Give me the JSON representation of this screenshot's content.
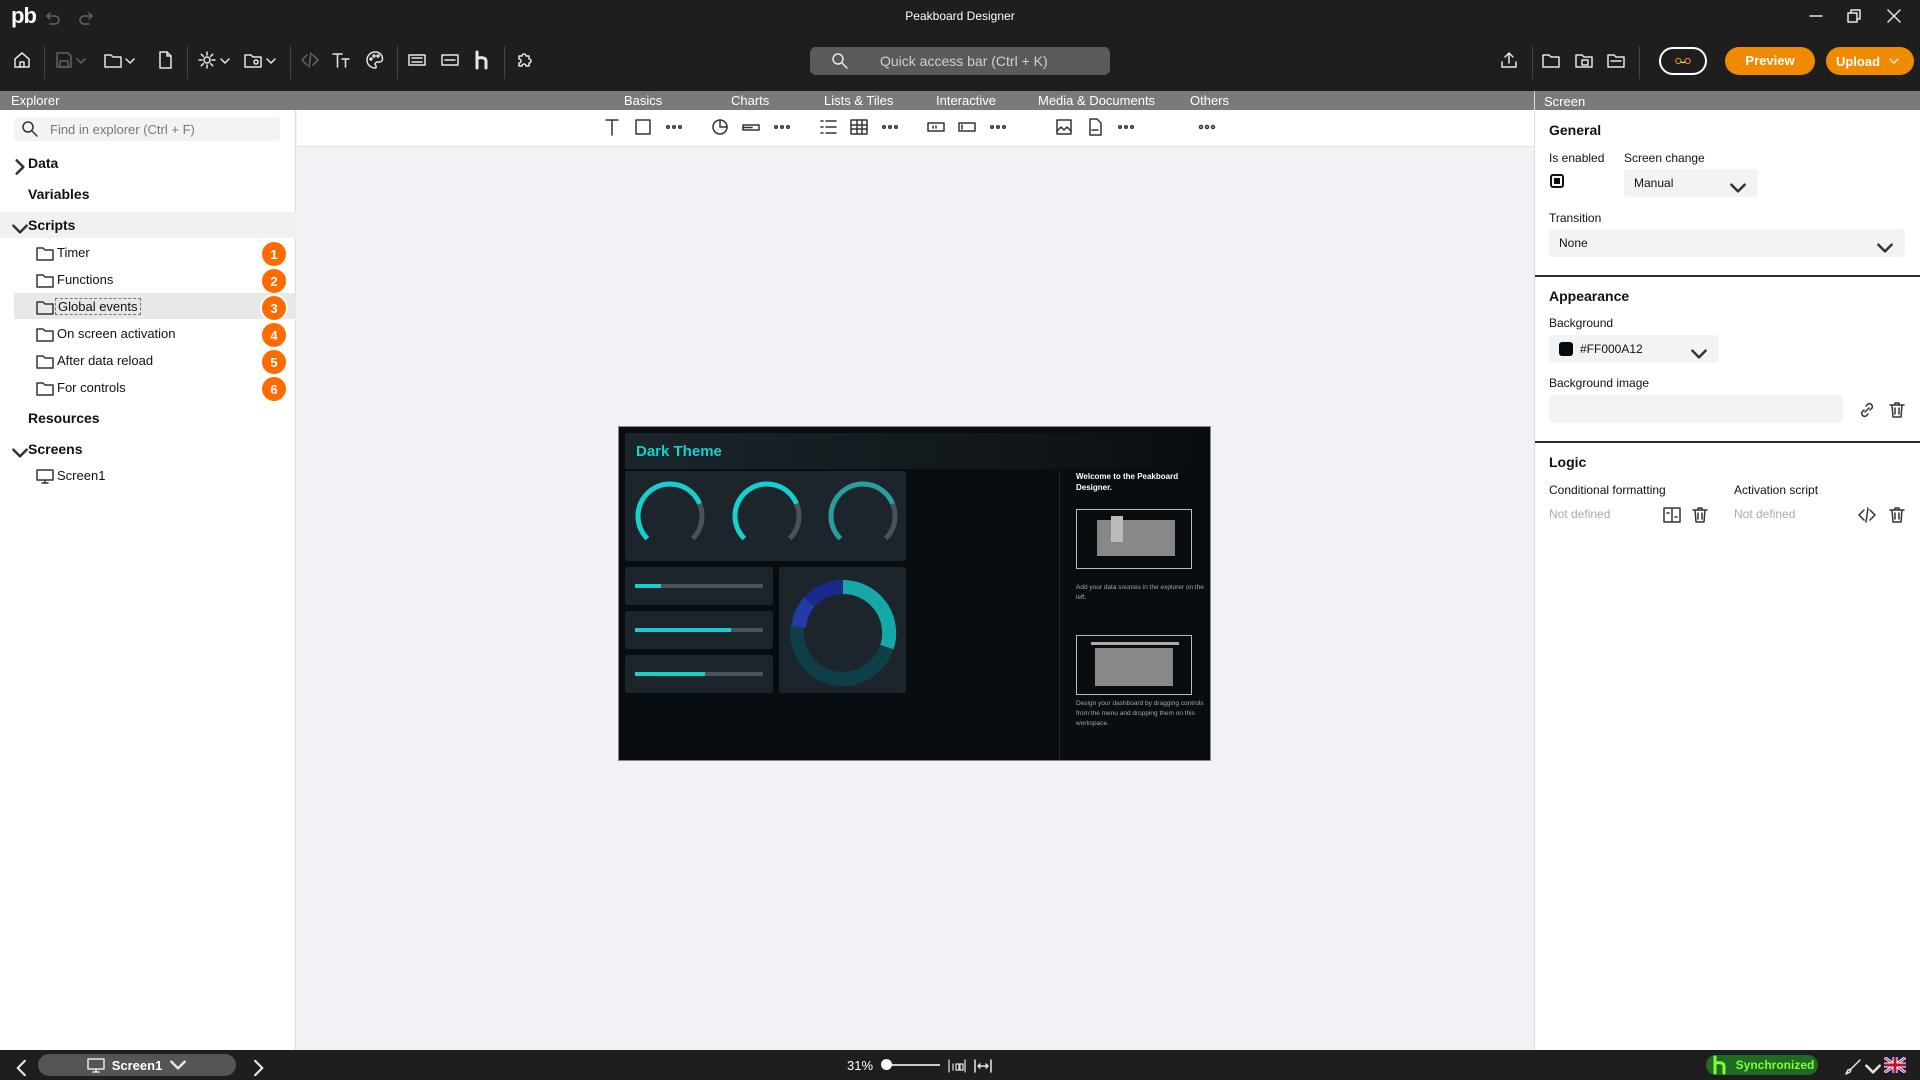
{
  "window": {
    "title": "Peakboard Designer",
    "logo": "pb"
  },
  "search": {
    "placeholder": "Quick access bar (Ctrl + K)"
  },
  "buttons": {
    "preview": "Preview",
    "upload": "Upload"
  },
  "categories": {
    "explorer": "Explorer",
    "basics": "Basics",
    "charts": "Charts",
    "lists_tiles": "Lists & Tiles",
    "interactive": "Interactive",
    "media_documents": "Media & Documents",
    "others": "Others",
    "screen": "Screen"
  },
  "explorer": {
    "search_placeholder": "Find in explorer (Ctrl + F)",
    "data": "Data",
    "variables": "Variables",
    "scripts": "Scripts",
    "resources": "Resources",
    "screens": "Screens",
    "script_items": [
      {
        "label": "Timer",
        "badge": "1"
      },
      {
        "label": "Functions",
        "badge": "2"
      },
      {
        "label": "Global events",
        "badge": "3"
      },
      {
        "label": "On screen activation",
        "badge": "4"
      },
      {
        "label": "After data reload",
        "badge": "5"
      },
      {
        "label": "For controls",
        "badge": "6"
      }
    ],
    "screen_items": [
      "Screen1"
    ]
  },
  "dashboard": {
    "title": "Dark Theme",
    "welcome": "Welcome to the Peakboard Designer.",
    "tip1": "Add your data sources in the explorer on the left.",
    "tip2": "Design your dashboard by dragging controls from the menu and dropping them on this workspace.",
    "gauges": [
      0.75,
      0.75,
      0.75
    ],
    "progress": [
      0.2,
      0.75,
      0.55
    ],
    "accent": "#16d0cc"
  },
  "properties": {
    "general": "General",
    "is_enabled": "Is enabled",
    "is_enabled_value": true,
    "screen_change": "Screen change",
    "screen_change_value": "Manual",
    "transition": "Transition",
    "transition_value": "None",
    "appearance": "Appearance",
    "background": "Background",
    "background_value": "#FF000A12",
    "background_image": "Background image",
    "logic": "Logic",
    "conditional_formatting": "Conditional formatting",
    "activation_script": "Activation script",
    "not_defined": "Not defined"
  },
  "status": {
    "screen": "Screen1",
    "zoom": "31%",
    "sync": "Synchronized"
  }
}
